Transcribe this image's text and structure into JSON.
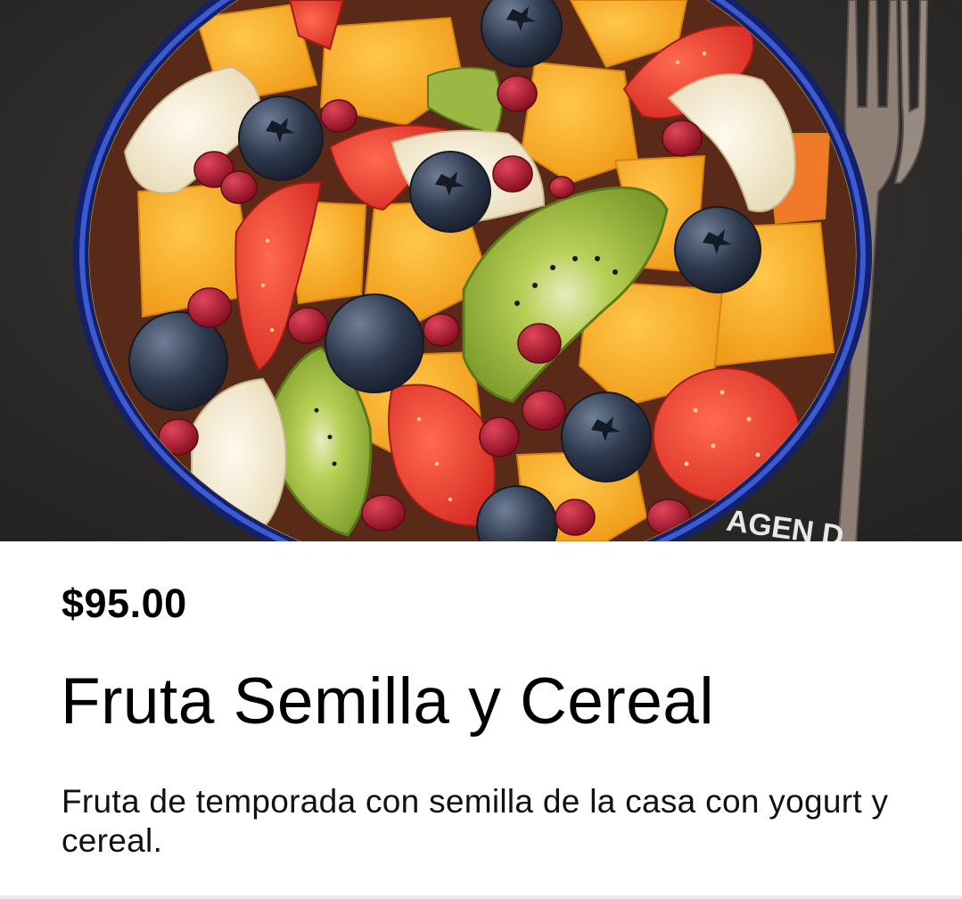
{
  "product": {
    "price": "$95.00",
    "title": "Fruta Semilla y Cereal",
    "description": "Fruta de temporada con semilla de la casa con yogurt y cereal.",
    "image_watermark": "AGEN D"
  },
  "colors": {
    "background": "#ffffff",
    "text": "#000000",
    "table_dark": "#2e2d2c",
    "bowl_blue": "#1b2c7a",
    "mango": "#f6a823",
    "strawberry": "#e23a2c",
    "kiwi": "#8fb23a",
    "blueberry": "#2f3a4e",
    "banana": "#f3ecd6",
    "pomegranate": "#a3122a"
  },
  "icons": {
    "fork": "fork-icon"
  }
}
